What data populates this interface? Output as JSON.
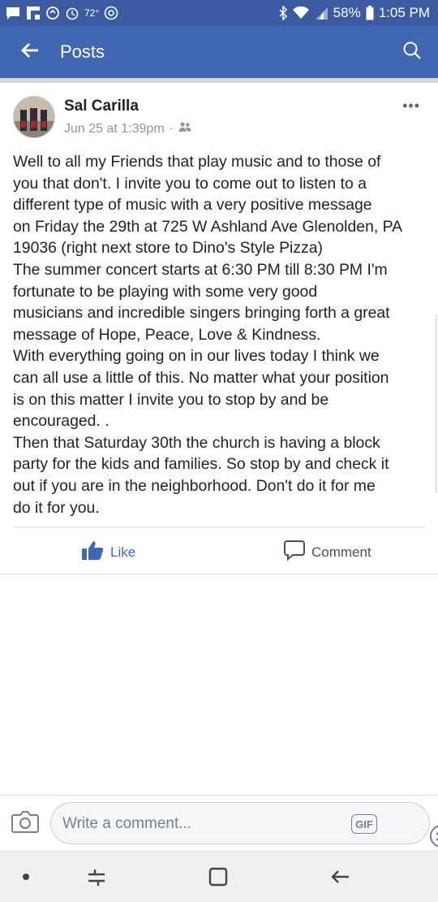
{
  "status_bar": {
    "temperature": "72°",
    "battery": "58%",
    "time": "1:05 PM",
    "icons": [
      "messenger-icon",
      "flipboard-icon",
      "sync-icon",
      "alarm-icon",
      "weather-icon",
      "at-icon",
      "bluetooth-icon",
      "wifi-icon",
      "signal-icon",
      "battery-icon"
    ]
  },
  "app_bar": {
    "title": "Posts",
    "back_icon": "arrow-left-icon",
    "search_icon": "search-icon"
  },
  "post": {
    "author": "Sal Carilla",
    "date": "Jun 25 at 1:39pm",
    "audience_icon": "friends-icon",
    "lines": [
      "Well to all my Friends that play music and to those of",
      "you that don't. I invite you to come out to listen to a",
      "different type of music with a very positive message",
      "on Friday the 29th at 725 W Ashland Ave Glenolden, PA",
      "19036 (right next store to Dino's Style Pizza)",
      "The summer concert starts at 6:30 PM till 8:30 PM I'm",
      "fortunate to be playing with some very good",
      "musicians and incredible singers bringing forth a great",
      "message of Hope, Peace, Love & Kindness.",
      "With everything going on in our lives today I think we",
      "can all use a little of this. No matter what your position",
      "is on this matter I invite you to stop by and be",
      "encouraged. .",
      "Then that Saturday 30th the church is having a block",
      "party for the kids and families. So stop by and check it",
      "out if you are in the neighborhood. Don't do it for me",
      "do it for you."
    ]
  },
  "actions": {
    "like_label": "Like",
    "comment_label": "Comment"
  },
  "composer": {
    "placeholder": "Write a comment...",
    "gif_label": "GIF"
  },
  "colors": {
    "status_bar": "#3b5aa1",
    "app_bar": "#4267b2",
    "like_blue": "#4267b2",
    "text": "#1d2129",
    "meta": "#90949c"
  }
}
